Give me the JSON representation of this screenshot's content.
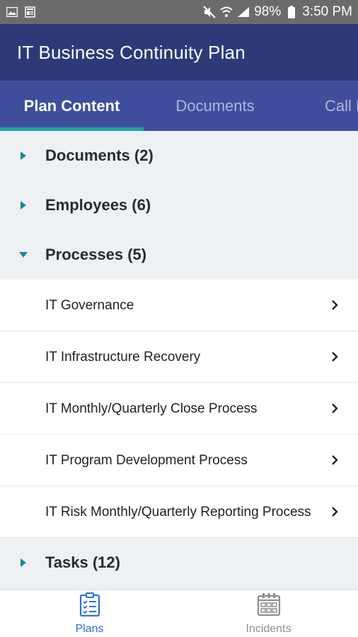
{
  "status_bar": {
    "battery": "98%",
    "time": "3:50 PM",
    "icons": [
      "image-icon",
      "news-icon",
      "mute-icon",
      "wifi-icon",
      "signal-icon",
      "battery-icon"
    ]
  },
  "app_bar": {
    "title": "IT Business Continuity Plan"
  },
  "tabs": [
    {
      "label": "Plan Content",
      "active": true
    },
    {
      "label": "Documents",
      "active": false
    },
    {
      "label": "Call L",
      "active": false
    }
  ],
  "sections": {
    "documents": {
      "label": "Documents (2)",
      "expanded": false
    },
    "employees": {
      "label": "Employees (6)",
      "expanded": false
    },
    "processes": {
      "label": "Processes (5)",
      "expanded": true
    },
    "tasks": {
      "label": "Tasks (12)",
      "expanded": false
    }
  },
  "processes": [
    "IT Governance",
    "IT Infrastructure Recovery",
    "IT Monthly/Quarterly Close Process",
    "IT Program Development Process",
    "IT Risk Monthly/Quarterly Reporting Process"
  ],
  "bottom_nav": {
    "plans": {
      "label": "Plans",
      "icon": "clipboard-checklist-icon"
    },
    "incidents": {
      "label": "Incidents",
      "icon": "calendar-icon"
    }
  },
  "colors": {
    "app_bar": "#2e3a78",
    "tab_bar": "#3f4e9c",
    "tab_indicator": "#1aa5a0",
    "caret": "#1a8a8c",
    "nav_active": "#2f6fd6",
    "nav_inactive": "#8e8e8e"
  }
}
